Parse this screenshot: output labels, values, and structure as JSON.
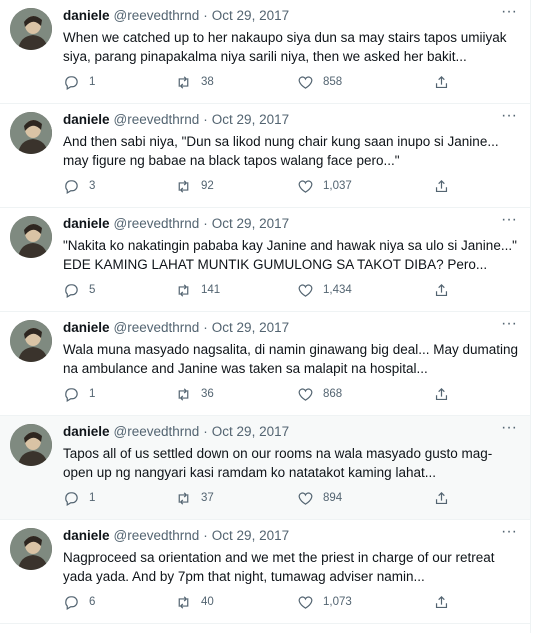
{
  "colors": {
    "text": "#0f1419",
    "muted": "#536471",
    "border": "#eff3f4",
    "hover_bg": "#f7f9f9"
  },
  "icons": {
    "reply": "reply-icon",
    "retweet": "retweet-icon",
    "like": "heart-icon",
    "share": "share-icon",
    "more": "more-icon"
  },
  "tweets": [
    {
      "name": "daniele",
      "handle": "@reevedthrnd",
      "dot": "·",
      "date": "Oct 29, 2017",
      "text": "When we catched up to her nakaupo siya dun sa may stairs tapos umiiyak siya, parang pinapakalma niya sarili niya, then we asked her bakit...",
      "replies": "1",
      "retweets": "38",
      "likes": "858"
    },
    {
      "name": "daniele",
      "handle": "@reevedthrnd",
      "dot": "·",
      "date": "Oct 29, 2017",
      "text": "And then sabi niya, \"Dun sa likod nung chair kung saan inupo si Janine... may figure ng babae na black tapos walang face pero...\"",
      "replies": "3",
      "retweets": "92",
      "likes": "1,037"
    },
    {
      "name": "daniele",
      "handle": "@reevedthrnd",
      "dot": "·",
      "date": "Oct 29, 2017",
      "text": "\"Nakita ko nakatingin pababa kay Janine and hawak niya sa ulo si Janine...\" EDE KAMING LAHAT MUNTIK GUMULONG SA TAKOT DIBA? Pero...",
      "replies": "5",
      "retweets": "141",
      "likes": "1,434"
    },
    {
      "name": "daniele",
      "handle": "@reevedthrnd",
      "dot": "·",
      "date": "Oct 29, 2017",
      "text": "Wala muna masyado nagsalita, di namin ginawang big deal... May dumating na ambulance and Janine was taken sa malapit na hospital...",
      "replies": "1",
      "retweets": "36",
      "likes": "868"
    },
    {
      "name": "daniele",
      "handle": "@reevedthrnd",
      "dot": "·",
      "date": "Oct 29, 2017",
      "text": "Tapos all of us settled down on our rooms na wala masyado gusto mag-open up ng nangyari kasi ramdam ko natatakot kaming lahat...",
      "replies": "1",
      "retweets": "37",
      "likes": "894"
    },
    {
      "name": "daniele",
      "handle": "@reevedthrnd",
      "dot": "·",
      "date": "Oct 29, 2017",
      "text": "Nagproceed sa orientation and we met the priest in charge of our retreat yada yada. And by 7pm that night, tumawag adviser namin...",
      "replies": "6",
      "retweets": "40",
      "likes": "1,073"
    }
  ]
}
